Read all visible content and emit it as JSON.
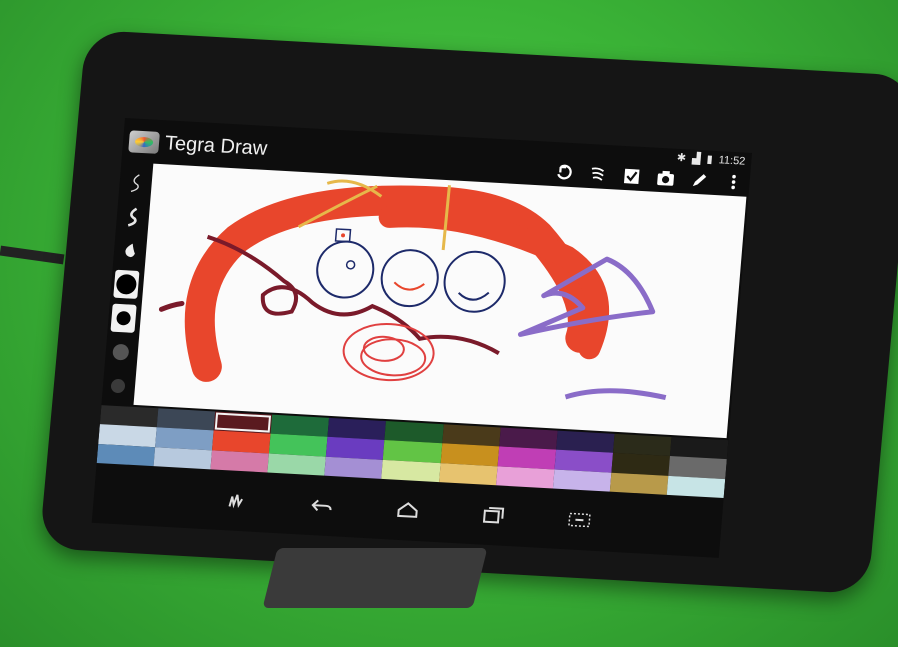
{
  "app": {
    "title": "Tegra Draw"
  },
  "status_bar": {
    "time": "11:52"
  },
  "toolbar": {
    "items": [
      {
        "icon": "undo-icon"
      },
      {
        "icon": "brush-settings-icon"
      },
      {
        "icon": "checkmark-icon"
      },
      {
        "icon": "camera-icon"
      },
      {
        "icon": "pencil-icon"
      },
      {
        "icon": "overflow-menu-icon"
      }
    ]
  },
  "brush_rail": {
    "items": [
      {
        "icon": "thin-stroke-icon"
      },
      {
        "icon": "medium-stroke-icon"
      },
      {
        "icon": "blob-brush-icon"
      },
      {
        "icon": "large-dot-icon",
        "selected": true
      },
      {
        "icon": "medium-dot-icon"
      },
      {
        "icon": "small-dot-icon"
      },
      {
        "icon": "faint-dot-icon"
      }
    ]
  },
  "palette": {
    "colors": [
      "#2a2a2a",
      "#3c4756",
      "#5a1a1f",
      "#1e6b3a",
      "#2a1f5a",
      "#1d5a2a",
      "#4a3a1a",
      "#4a1a4a",
      "#2a2050",
      "#2b2b1a",
      "#1a1a1a",
      "#c9d8e6",
      "#7e9ec4",
      "#e8462c",
      "#44c35a",
      "#6a3cc0",
      "#62c445",
      "#c8901e",
      "#c03eb5",
      "#8a4ec8",
      "#2e2a14",
      "#6a6a6a",
      "#5d8bb8",
      "#b7c9de",
      "#d57aa8",
      "#9ad8a8",
      "#a48fd4",
      "#d7e8a2",
      "#e7c36f",
      "#e8a0d8",
      "#c7b3ea",
      "#b89a4a",
      "#c7e4e6"
    ],
    "selected_index": 2
  },
  "nav_bar": {
    "items": [
      {
        "icon": "gesture-icon"
      },
      {
        "icon": "back-icon"
      },
      {
        "icon": "home-icon"
      },
      {
        "icon": "recents-icon"
      },
      {
        "icon": "screenshot-icon"
      }
    ]
  }
}
